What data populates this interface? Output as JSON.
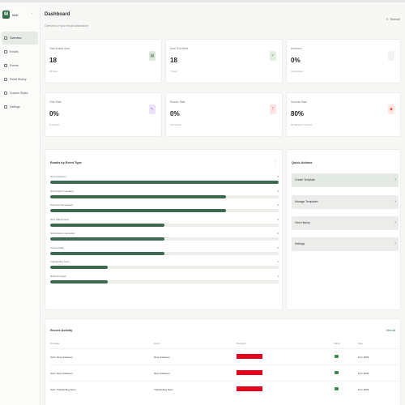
{
  "brand": {
    "name": "Mail",
    "logo": "M"
  },
  "sidebar": {
    "items": [
      {
        "label": "Overview",
        "active": true
      },
      {
        "label": "Emails"
      },
      {
        "label": "Events"
      },
      {
        "label": "Email History"
      },
      {
        "label": "Custom Styles"
      },
      {
        "label": "Settings"
      }
    ]
  },
  "header": {
    "title": "Dashboard",
    "subtitle": "Overview of your email automation",
    "refresh_label": "Refresh"
  },
  "stats": [
    {
      "label": "Total Emails Sent",
      "value": "18",
      "sub": "All time",
      "icon": "mail-icon",
      "color": "#dde6dc",
      "fg": "#4b6a52"
    },
    {
      "label": "Sent This Week",
      "value": "18",
      "sub": "7 days",
      "icon": "send-icon",
      "color": "#e3efe0",
      "fg": "#3c8a50"
    },
    {
      "label": "Delivered",
      "value": "0%",
      "sub": "0 delivered",
      "icon": "check-icon",
      "color": "#f3f3f1",
      "fg": "#888888"
    },
    {
      "label": "Click Rate",
      "value": "0%",
      "sub": "0 clicked",
      "icon": "cursor-icon",
      "color": "#ece3fb",
      "fg": "#8a5bd6"
    },
    {
      "label": "Bounce Rate",
      "value": "0%",
      "sub": "0 bounced",
      "icon": "alert-icon",
      "color": "#fde3e3",
      "fg": "#d04545"
    },
    {
      "label": "Success Rate",
      "value": "80%",
      "sub": "All delivery success",
      "icon": "shield-icon",
      "color": "#fde6e1",
      "fg": "#e05a45"
    }
  ],
  "events_panel": {
    "title": "Emails by Event Type",
    "rows": [
      {
        "label": "New Customer",
        "count": "5",
        "fraction": 1.0
      },
      {
        "label": "Subscription Updated",
        "count": "4",
        "fraction": 0.77
      },
      {
        "label": "Payment Succeeded",
        "count": "4",
        "fraction": 0.77
      },
      {
        "label": "New Subscription",
        "count": "2",
        "fraction": 0.5
      },
      {
        "label": "Subscription Canceled",
        "count": "2",
        "fraction": 0.5
      },
      {
        "label": "Invoice Paid",
        "count": "2",
        "fraction": 0.5
      },
      {
        "label": "Trial Ending Soon",
        "count": "1",
        "fraction": 0.25
      },
      {
        "label": "Refund Issued",
        "count": "1",
        "fraction": 0.25
      }
    ]
  },
  "quick_actions": {
    "title": "Quick Actions",
    "items": [
      "Create Template",
      "Manage Templates",
      "View History",
      "Settings"
    ]
  },
  "activity": {
    "title": "Recent Activity",
    "view_all": "View all",
    "columns": [
      "Template",
      "Event",
      "Recipient",
      "Status",
      "Date"
    ],
    "rows": [
      {
        "template": "Tech: New Customer",
        "event": "New Customer",
        "date": "10.1.2025"
      },
      {
        "template": "Tech: New Customer",
        "event": "New Customer",
        "date": "10.1.2025"
      },
      {
        "template": "Tech: Trial Ending Soon",
        "event": "Trial Ending Soon",
        "date": "10.1.2025"
      }
    ]
  }
}
